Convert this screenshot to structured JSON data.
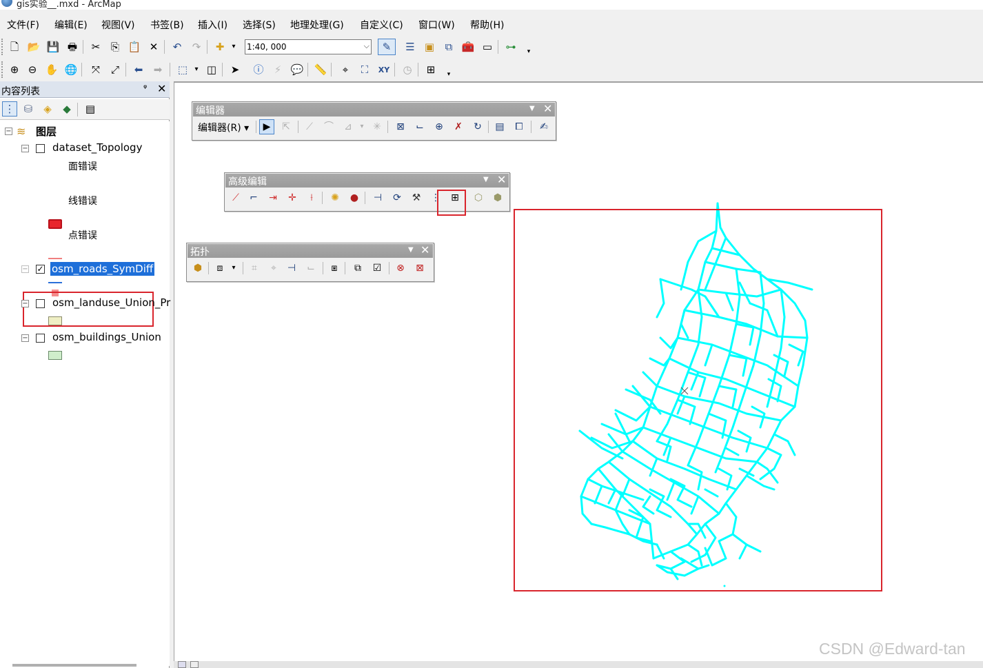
{
  "window": {
    "title": "gis实验__.mxd - ArcMap"
  },
  "menu": [
    "文件(F)",
    "编辑(E)",
    "视图(V)",
    "书签(B)",
    "插入(I)",
    "选择(S)",
    "地理处理(G)",
    "自定义(C)",
    "窗口(W)",
    "帮助(H)"
  ],
  "standard_toolbar": {
    "scale_value": "1:40, 000"
  },
  "toc": {
    "title": "内容列表",
    "pin": "ᵠ",
    "close": "✕",
    "root_label": "图层",
    "layers": [
      {
        "name": "dataset_Topology",
        "checked": false,
        "expanded": true,
        "symbols": [
          "面错误",
          "线错误",
          "点错误"
        ]
      },
      {
        "name": "osm_roads_SymDiff",
        "checked": true,
        "selected": true
      },
      {
        "name": "osm_landuse_Union_Pr",
        "checked": false
      },
      {
        "name": "osm_buildings_Union",
        "checked": false
      }
    ],
    "colors": {
      "poly_error": "#e8262d",
      "line_error": "#f07f7f",
      "point_error": "#f58c8c",
      "landuse": "#efefc4",
      "buildings": "#cfeecb",
      "selection": "#1e6fd9"
    }
  },
  "editor_toolbar": {
    "title": "编辑器",
    "menu_label": "编辑器(R) ▾"
  },
  "advanced_toolbar": {
    "title": "高级编辑"
  },
  "topology_toolbar": {
    "title": "拓扑"
  },
  "map": {
    "road_color": "#00ffff",
    "frame_color": "#d9242c"
  },
  "watermark": "CSDN @Edward-tan"
}
